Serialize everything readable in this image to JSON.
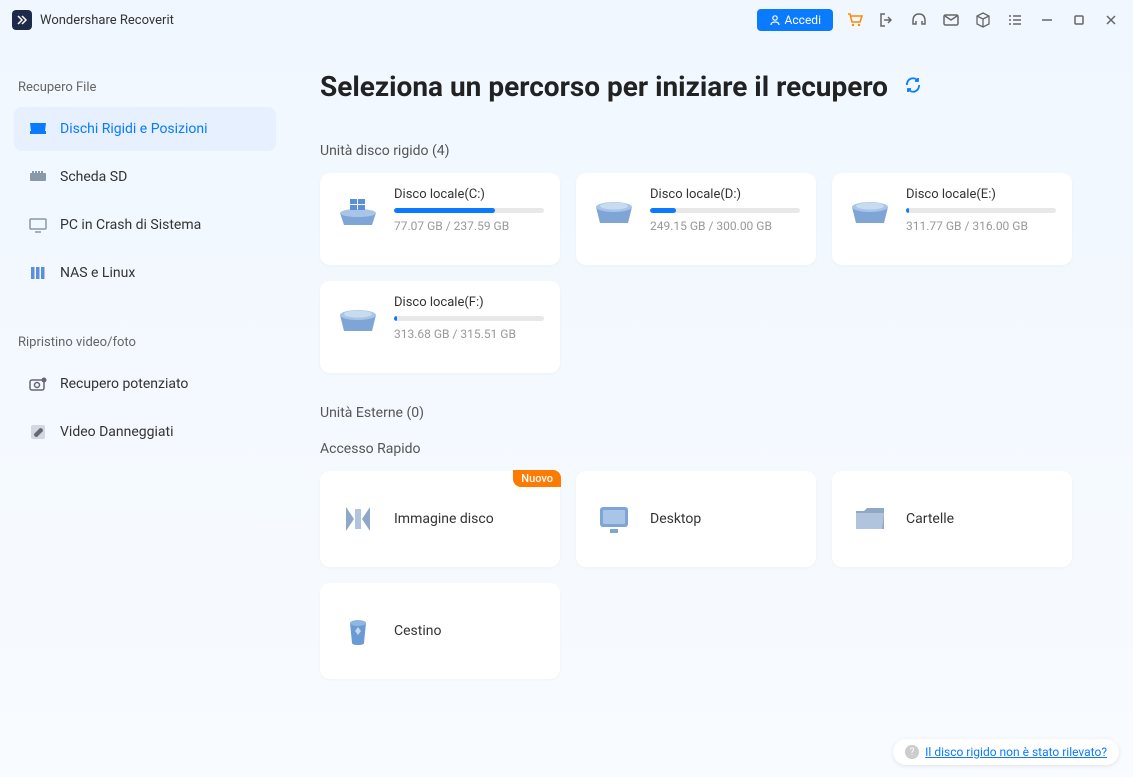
{
  "app": {
    "title": "Wondershare Recoverit"
  },
  "titlebar": {
    "accedi": "Accedi"
  },
  "sidebar": {
    "section1_title": "Recupero File",
    "section2_title": "Ripristino video/foto",
    "items1": [
      {
        "label": "Dischi Rigidi e Posizioni"
      },
      {
        "label": "Scheda SD"
      },
      {
        "label": "PC in Crash di Sistema"
      },
      {
        "label": "NAS e Linux"
      }
    ],
    "items2": [
      {
        "label": "Recupero potenziato"
      },
      {
        "label": "Video Danneggiati"
      }
    ]
  },
  "page": {
    "title": "Seleziona un percorso per iniziare il recupero",
    "hdd_section": "Unità disco rigido (4)",
    "ext_section": "Unità Esterne (0)",
    "quick_section": "Accesso Rapido"
  },
  "drives": [
    {
      "name": "Disco locale(C:)",
      "stats": "77.07 GB / 237.59 GB",
      "pct": 67,
      "type": "windows"
    },
    {
      "name": "Disco locale(D:)",
      "stats": "249.15 GB / 300.00 GB",
      "pct": 17,
      "type": "local"
    },
    {
      "name": "Disco locale(E:)",
      "stats": "311.77 GB / 316.00 GB",
      "pct": 2,
      "type": "local"
    },
    {
      "name": "Disco locale(F:)",
      "stats": "313.68 GB / 315.51 GB",
      "pct": 2,
      "type": "local"
    }
  ],
  "quick": [
    {
      "label": "Immagine disco",
      "badge": "Nuovo",
      "icon": "disk-image"
    },
    {
      "label": "Desktop",
      "icon": "desktop"
    },
    {
      "label": "Cartelle",
      "icon": "folder"
    },
    {
      "label": "Cestino",
      "icon": "trash"
    }
  ],
  "help": {
    "text": "Il disco rigido non è stato rilevato?"
  }
}
